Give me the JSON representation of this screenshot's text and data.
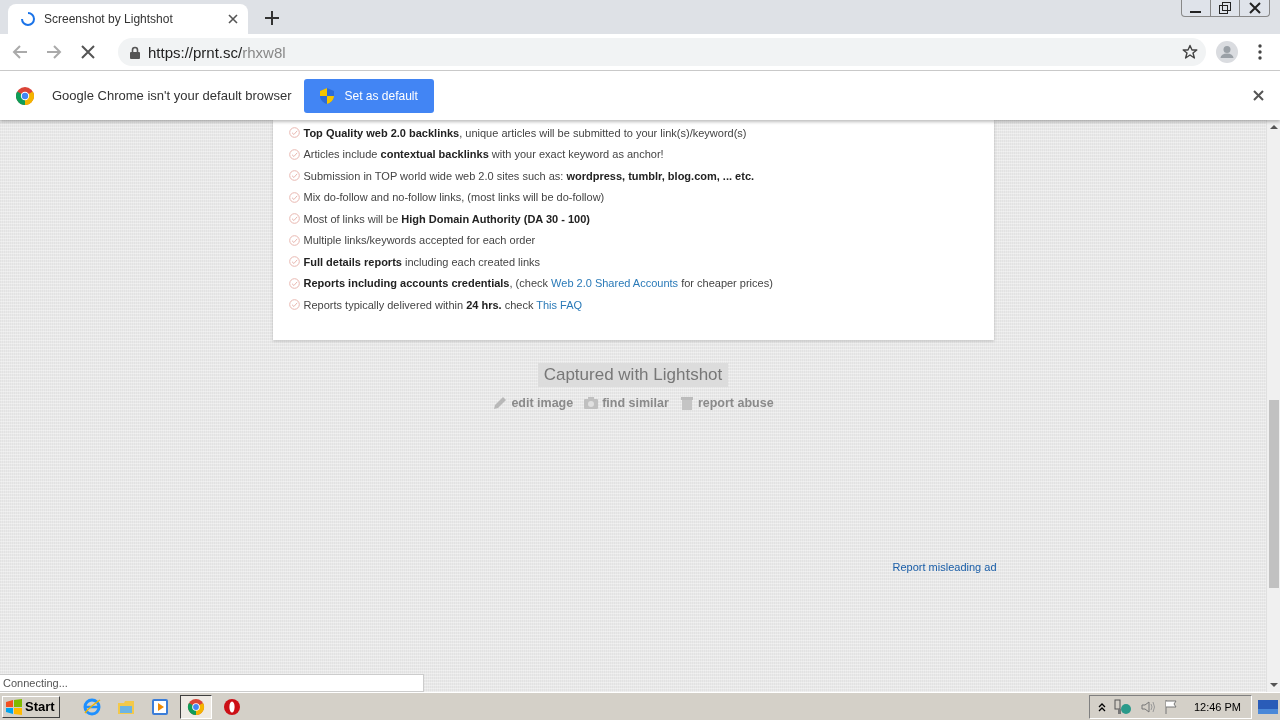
{
  "tab": {
    "title": "Screenshot by Lightshot",
    "loading": true
  },
  "address_bar": {
    "host": "https://prnt.sc/",
    "path": "rhxw8l"
  },
  "infobar": {
    "message": "Google Chrome isn't your default browser",
    "button": "Set as default"
  },
  "features": [
    {
      "segments": [
        {
          "kind": "text",
          "text": "**Top Quality web 2.0 backlinks**, unique articles will be submitted to your link(s)/keyword(s)"
        }
      ]
    },
    {
      "segments": [
        {
          "kind": "text",
          "text": "Articles include **contextual backlinks** with your exact keyword as anchor!"
        }
      ]
    },
    {
      "segments": [
        {
          "kind": "text",
          "text": "Submission in TOP world wide web 2.0 sites such as: **wordpress, tumblr, blog.com, ... etc.**"
        }
      ]
    },
    {
      "segments": [
        {
          "kind": "text",
          "text": "Mix do-follow and no-follow links, (most links will be do-follow)"
        }
      ]
    },
    {
      "segments": [
        {
          "kind": "text",
          "text": "Most of links will be **High Domain Authority (DA 30 - 100)**"
        }
      ]
    },
    {
      "segments": [
        {
          "kind": "text",
          "text": "Multiple links/keywords accepted for each order"
        }
      ]
    },
    {
      "segments": [
        {
          "kind": "text",
          "text": "**Full details reports** including each created links"
        }
      ]
    },
    {
      "segments": [
        {
          "kind": "text",
          "text": "**Reports including accounts credentials**, (check "
        },
        {
          "kind": "link",
          "text": "Web 2.0 Shared Accounts"
        },
        {
          "kind": "text",
          "text": " for cheaper prices)"
        }
      ]
    },
    {
      "segments": [
        {
          "kind": "text",
          "text": "Reports typically delivered within **24 hrs.** check "
        },
        {
          "kind": "link",
          "text": "This FAQ"
        }
      ]
    }
  ],
  "caption": "Captured with Lightshot",
  "actions": [
    {
      "kind": "edit",
      "label": "edit image"
    },
    {
      "kind": "camera",
      "label": "find similar"
    },
    {
      "kind": "trash",
      "label": "report abuse"
    }
  ],
  "ad_link": "Report misleading ad",
  "status_bubble": "Connecting...",
  "taskbar": {
    "start": "Start",
    "apps": [
      {
        "kind": "ie",
        "selected": false
      },
      {
        "kind": "folder",
        "selected": false
      },
      {
        "kind": "media",
        "selected": false
      },
      {
        "kind": "chrome",
        "selected": true
      },
      {
        "kind": "opera",
        "selected": false
      }
    ],
    "clock": "12:46 PM"
  }
}
